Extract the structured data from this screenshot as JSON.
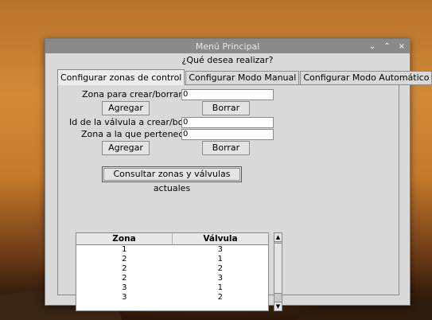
{
  "window": {
    "title": "Menú Principal",
    "controls": {
      "minimize": "⌄",
      "maximize": "⌃",
      "close": "×"
    }
  },
  "question": "¿Qué desea realizar?",
  "tabs": [
    {
      "label": "Configurar zonas de control",
      "active": true
    },
    {
      "label": "Configurar Modo Manual",
      "active": false
    },
    {
      "label": "Configurar Modo Automático",
      "active": false
    }
  ],
  "zone_form": {
    "label": "Zona para crear/borrar:",
    "value": "0",
    "add_label": "Agregar",
    "delete_label": "Borrar"
  },
  "valve_form": {
    "id_label": "Id de la válvula a crear/borrar:",
    "id_value": "0",
    "zone_label": "Zona a la que pertenece:",
    "zone_value": "0",
    "add_label": "Agregar",
    "delete_label": "Borrar"
  },
  "consult_button": "Consultar zonas y válvulas actuales",
  "table": {
    "headers": [
      "Zona",
      "Válvula"
    ],
    "rows": [
      [
        "1",
        "3"
      ],
      [
        "2",
        "1"
      ],
      [
        "2",
        "2"
      ],
      [
        "2",
        "3"
      ],
      [
        "3",
        "1"
      ],
      [
        "3",
        "2"
      ]
    ]
  }
}
